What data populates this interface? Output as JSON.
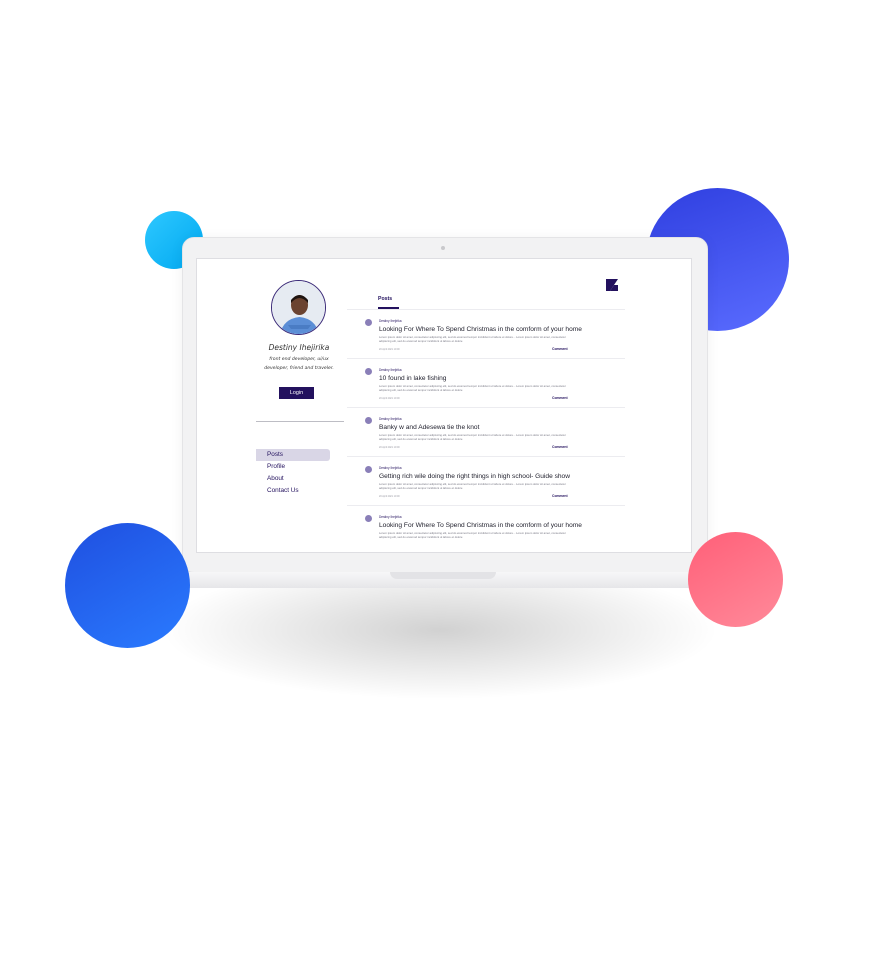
{
  "colors": {
    "accent": "#23115e",
    "nav_active_bg": "#d9d6e6"
  },
  "profile": {
    "name": "Destiny Ihejirika",
    "bio": "front end developer, ui/ux developer, friend and traveler.",
    "login_label": "Login"
  },
  "nav": {
    "items": [
      {
        "label": "Posts",
        "active": true
      },
      {
        "label": "Profile",
        "active": false
      },
      {
        "label": "About",
        "active": false
      },
      {
        "label": "Contact Us",
        "active": false
      }
    ]
  },
  "tabs": {
    "active": "Posts"
  },
  "posts": [
    {
      "author": "Destiny Ihejirika",
      "title": "Looking For Where To Spend Christmas in the comform of your home",
      "excerpt": "Lorem ipsum dolor sit amet, consectetur adipiscing elit, sed do eiusmod tempor incididunt ut labore et dolore... Lorem ipsum dolor sit amet, consectetur adipiscing elit, sed do eiusmod tempor incididunt ut labore et dolore",
      "date": "20 April 2021 10:00",
      "comment_label": "Comment"
    },
    {
      "author": "Destiny Ihejirika",
      "title": "10 found in lake fishing",
      "excerpt": "Lorem ipsum dolor sit amet, consectetur adipiscing elit, sed do eiusmod tempor incididunt ut labore et dolore... Lorem ipsum dolor sit amet, consectetur adipiscing elit, sed do eiusmod tempor incididunt ut labore et dolore",
      "date": "20 April 2021 10:00",
      "comment_label": "Comment"
    },
    {
      "author": "Destiny Ihejirika",
      "title": "Banky w and Adesewa tie the knot",
      "excerpt": "Lorem ipsum dolor sit amet, consectetur adipiscing elit, sed do eiusmod tempor incididunt ut labore et dolore... Lorem ipsum dolor sit amet, consectetur adipiscing elit, sed do eiusmod tempor incididunt ut labore et dolore",
      "date": "20 April 2021 10:00",
      "comment_label": "Comment"
    },
    {
      "author": "Destiny Ihejirika",
      "title": "Getting rich wile doing the right things in high school- Guide show",
      "excerpt": "Lorem ipsum dolor sit amet, consectetur adipiscing elit, sed do eiusmod tempor incididunt ut labore et dolore... Lorem ipsum dolor sit amet, consectetur adipiscing elit, sed do eiusmod tempor incididunt ut labore et dolore",
      "date": "20 April 2021 10:00",
      "comment_label": "Comment"
    },
    {
      "author": "Destiny Ihejirika",
      "title": "Looking For Where To Spend Christmas in the comform of your home",
      "excerpt": "Lorem ipsum dolor sit amet, consectetur adipiscing elit, sed do eiusmod tempor incididunt ut labore et dolore... Lorem ipsum dolor sit amet, consectetur adipiscing elit, sed do eiusmod tempor incididunt ut labore et dolore",
      "date": "",
      "comment_label": ""
    }
  ]
}
